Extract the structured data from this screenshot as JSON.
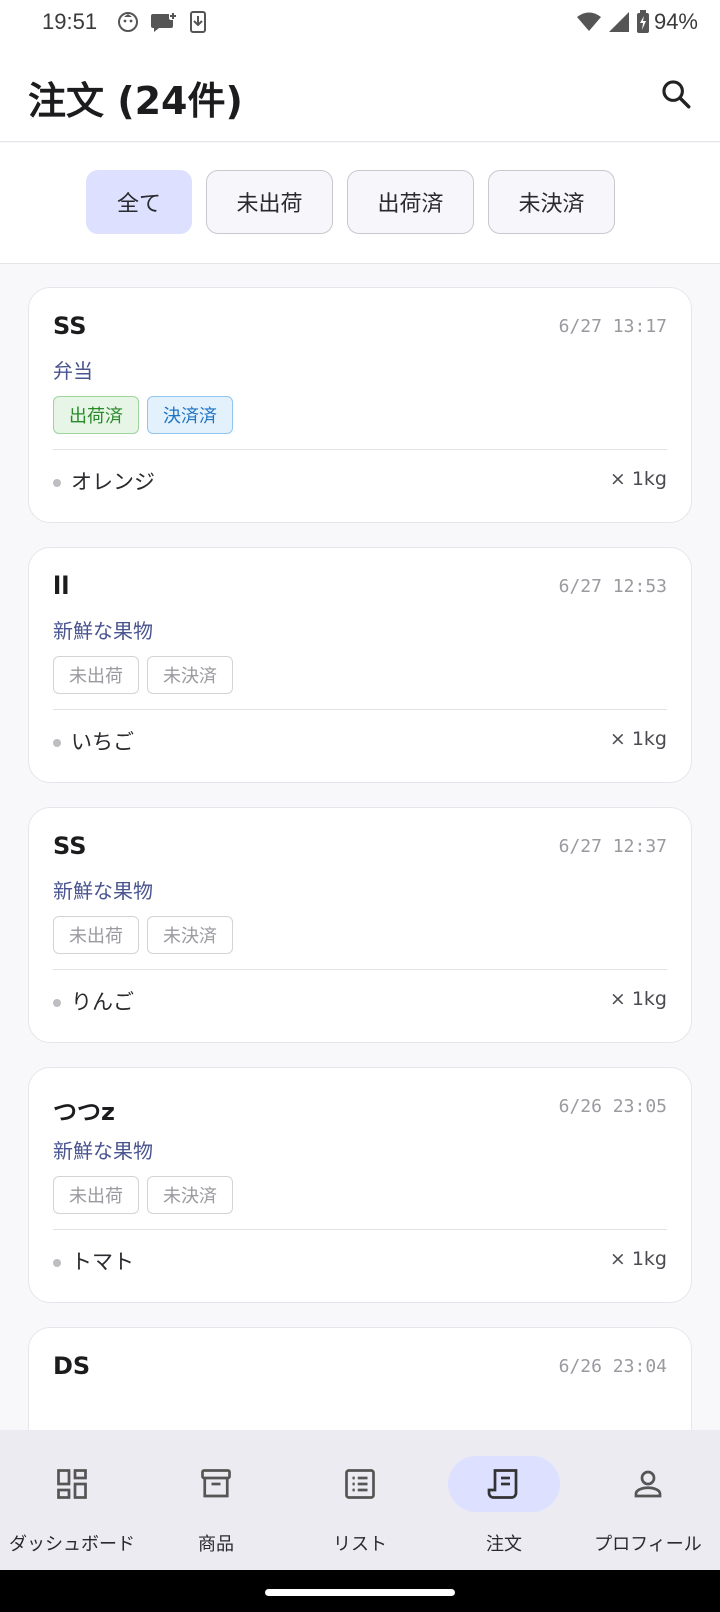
{
  "status_bar": {
    "time": "19:51",
    "battery": "94%"
  },
  "header": {
    "title": "注文 (24件)",
    "search_icon": "search-icon"
  },
  "filters": [
    {
      "label": "全て",
      "active": true
    },
    {
      "label": "未出荷",
      "active": false
    },
    {
      "label": "出荷済",
      "active": false
    },
    {
      "label": "未決済",
      "active": false
    }
  ],
  "orders": [
    {
      "customer": "SS",
      "time": "6/27 13:17",
      "shop": "弁当",
      "shipping": "出荷済",
      "payment": "決済済",
      "item": "オレンジ",
      "qty": "× 1kg"
    },
    {
      "customer": "ll",
      "time": "6/27 12:53",
      "shop": "新鮮な果物",
      "shipping": "未出荷",
      "payment": "未決済",
      "item": "いちご",
      "qty": "× 1kg"
    },
    {
      "customer": "SS",
      "time": "6/27 12:37",
      "shop": "新鮮な果物",
      "shipping": "未出荷",
      "payment": "未決済",
      "item": "りんご",
      "qty": "× 1kg"
    },
    {
      "customer": "つつz",
      "time": "6/26 23:05",
      "shop": "新鮮な果物",
      "shipping": "未出荷",
      "payment": "未決済",
      "item": "トマト",
      "qty": "× 1kg"
    },
    {
      "customer": "DS",
      "time": "6/26 23:04"
    }
  ],
  "bottom_nav": [
    {
      "label": "ダッシュボード",
      "icon": "dashboard-icon",
      "active": false
    },
    {
      "label": "商品",
      "icon": "archive-box-icon",
      "active": false
    },
    {
      "label": "リスト",
      "icon": "list-icon",
      "active": false
    },
    {
      "label": "注文",
      "icon": "receipt-icon",
      "active": true
    },
    {
      "label": "プロフィール",
      "icon": "person-icon",
      "active": false
    }
  ],
  "colors": {
    "accent": "#dde0ff",
    "shop_text": "#4a5590",
    "shipped_badge": "#2a8a2a",
    "paid_badge": "#1f74c2"
  }
}
